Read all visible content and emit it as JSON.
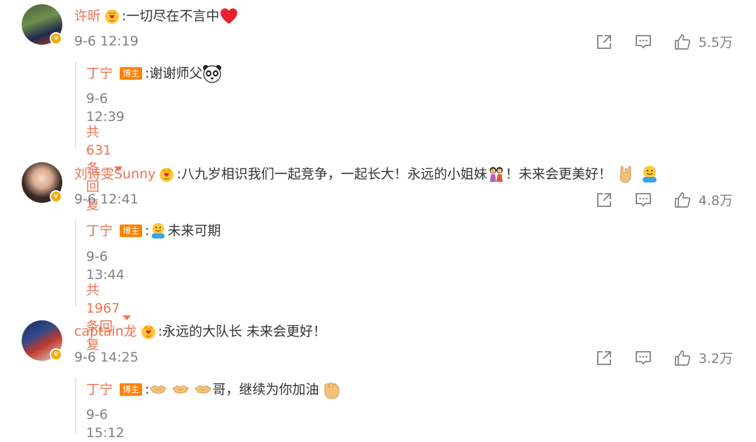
{
  "colors": {
    "username": "#eb7350",
    "meta": "#808080",
    "badge": "#ff8200",
    "text": "#333333"
  },
  "comments": [
    {
      "user": "许昕",
      "text": ":一切尽在不言中",
      "time": "9-6 12:19",
      "likes": "5.5万",
      "reply": {
        "user": "丁宁",
        "badge": "博主",
        "text": ":谢谢师父",
        "time": "9-6 12:39"
      },
      "more": "共631条回复"
    },
    {
      "user": "刘诗雯Sunny",
      "text_a": ":八九岁相识我们一起竞争，一起长大！永远的小姐妹",
      "text_b": "！未来会更美好！",
      "time": "9-6 12:41",
      "likes": "4.8万",
      "reply": {
        "user": "丁宁",
        "badge": "博主",
        "text_a": ":",
        "text_b": "未来可期",
        "time": "9-6 13:44"
      },
      "more": "共1967条回复"
    },
    {
      "user": "captain龙",
      "text": ":永远的大队长 未来会更好！",
      "time": "9-6 14:25",
      "likes": "3.2万",
      "reply": {
        "user": "丁宁",
        "badge": "博主",
        "text_a": ":",
        "text_b": "哥，继续为你加油",
        "time": "9-6 15:12"
      }
    }
  ],
  "icons": {
    "share": "share-icon",
    "comment": "comment-icon",
    "like": "thumbs-up-icon",
    "crown": "crown-heart-icon",
    "verified": "verified-badge-icon"
  }
}
